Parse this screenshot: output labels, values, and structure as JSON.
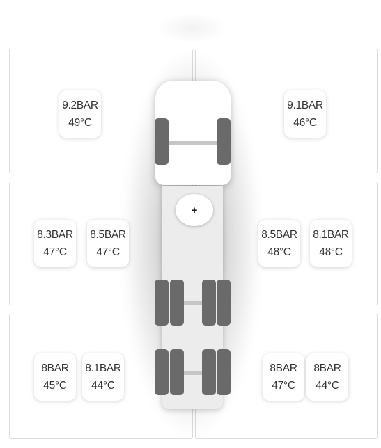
{
  "tyres": {
    "front_left": {
      "pressure": "9.2BAR",
      "temp": "49°C"
    },
    "front_right": {
      "pressure": "9.1BAR",
      "temp": "46°C"
    },
    "mid_left_outer": {
      "pressure": "8.3BAR",
      "temp": "47°C"
    },
    "mid_left_inner": {
      "pressure": "8.5BAR",
      "temp": "47°C"
    },
    "mid_right_inner": {
      "pressure": "8.5BAR",
      "temp": "48°C"
    },
    "mid_right_outer": {
      "pressure": "8.1BAR",
      "temp": "48°C"
    },
    "rear_left_outer": {
      "pressure": "8BAR",
      "temp": "45°C"
    },
    "rear_left_inner": {
      "pressure": "8.1BAR",
      "temp": "44°C"
    },
    "rear_right_inner": {
      "pressure": "8BAR",
      "temp": "47°C"
    },
    "rear_right_outer": {
      "pressure": "8BAR",
      "temp": "44°C"
    }
  },
  "truck": {
    "add_button_label": "+"
  },
  "icons": {
    "add": "plus-icon"
  },
  "colors": {
    "wheel": "#6a6a6a",
    "panel_border": "#dcdcdc",
    "text": "#333333"
  }
}
